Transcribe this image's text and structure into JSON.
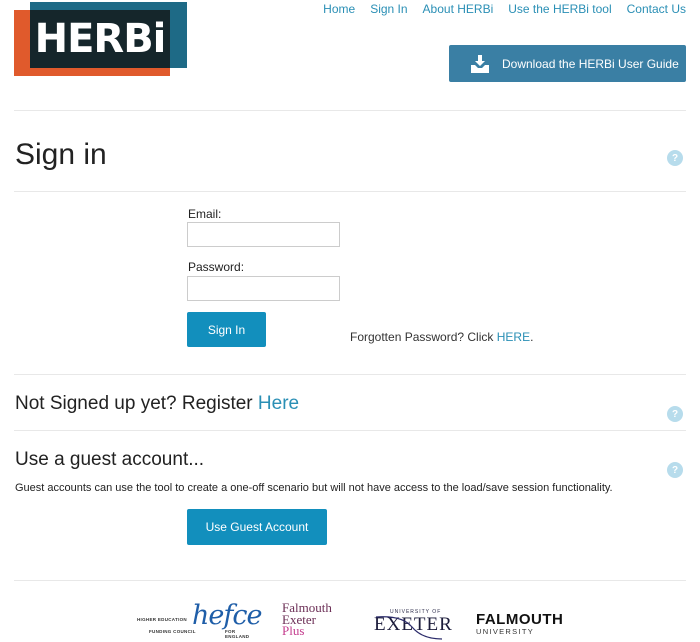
{
  "brand": {
    "logo_text": "HERBi",
    "colors": {
      "orange": "#e05a2c",
      "blue": "#1e6a86",
      "dark": "#15262b",
      "accent": "#128fbd",
      "link": "#2a8fb5"
    }
  },
  "nav": {
    "items": [
      {
        "label": "Home"
      },
      {
        "label": "Sign In"
      },
      {
        "label": "About HERBi"
      },
      {
        "label": "Use the HERBi tool"
      },
      {
        "label": "Contact Us"
      }
    ]
  },
  "download": {
    "label": "Download the HERBi User Guide",
    "icon": "download-icon"
  },
  "page": {
    "title": "Sign in",
    "help_icon": "question-icon",
    "help_glyph": "?"
  },
  "form": {
    "email_label": "Email:",
    "email_value": "",
    "password_label": "Password:",
    "password_value": "",
    "submit_label": "Sign In",
    "forgot_text": "Forgotten Password? Click ",
    "forgot_link": "HERE",
    "forgot_suffix": "."
  },
  "register": {
    "text": "Not Signed up yet? Register ",
    "link": "Here"
  },
  "guest": {
    "title": "Use a guest account...",
    "description": "Guest accounts can use the tool to create a one-off scenario but will not have access to the load/save session functionality.",
    "button_label": "Use Guest Account"
  },
  "footer": {
    "hefce": {
      "line1": "HIGHER EDUCATION",
      "name": "hefce",
      "line2a": "FUNDING COUNCIL",
      "line2b": "FOR ENGLAND"
    },
    "fep": {
      "line1": "Falmouth",
      "line2": "Exeter",
      "line3": "Plus"
    },
    "exeter": {
      "top": "UNIVERSITY OF",
      "name": "EXETER"
    },
    "falmouth": {
      "name": "FALMOUTH",
      "sub": "UNIVERSITY"
    }
  }
}
